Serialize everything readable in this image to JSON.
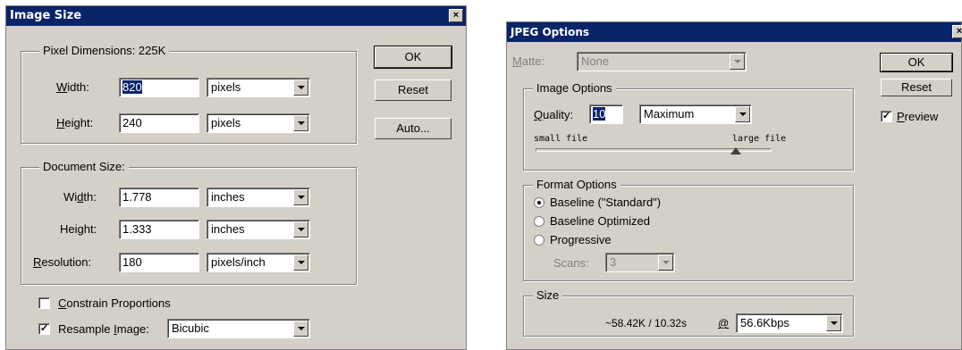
{
  "image_size": {
    "title": "Image Size",
    "close_glyph": "×",
    "pixel_dimensions": {
      "legend": "Pixel Dimensions: 225K",
      "width": {
        "label_pre": "",
        "label_key": "W",
        "label_post": "idth:",
        "value": "820",
        "unit": "pixels"
      },
      "height": {
        "label_pre": "",
        "label_key": "H",
        "label_post": "eight:",
        "value": "240",
        "unit": "pixels"
      }
    },
    "document_size": {
      "legend": "Document Size:",
      "width": {
        "label_pre": "Wi",
        "label_key": "d",
        "label_post": "th:",
        "value": "1.778",
        "unit": "inches"
      },
      "height": {
        "label_pre": "Hei",
        "label_key": "g",
        "label_post": "ht:",
        "value": "1.333",
        "unit": "inches"
      },
      "resolution": {
        "label_pre": "",
        "label_key": "R",
        "label_post": "esolution:",
        "value": "180",
        "unit": "pixels/inch"
      }
    },
    "constrain": {
      "label_pre": "",
      "label_key": "C",
      "label_post": "onstrain Proportions",
      "checked": false
    },
    "resample": {
      "label_pre": "Resample ",
      "label_key": "I",
      "label_post": "mage:",
      "checked": true,
      "value": "Bicubic"
    },
    "ok_label": "OK",
    "reset_label": "Reset",
    "auto_label": "Auto..."
  },
  "jpeg_options": {
    "title": "JPEG Options",
    "close_glyph": "×",
    "matte": {
      "label_pre": "",
      "label_key": "M",
      "label_post": "atte:",
      "value": "None"
    },
    "image_options": {
      "legend": "Image Options",
      "quality_label_pre": "",
      "quality_label_key": "Q",
      "quality_label_post": "uality:",
      "quality_value": "10",
      "quality_preset": "Maximum",
      "small_label": "small file",
      "large_label": "large file",
      "slider_level": 0.85
    },
    "format_options": {
      "legend": "Format Options",
      "options": [
        {
          "label": "Baseline (\"Standard\")",
          "selected": true
        },
        {
          "label": "Baseline Optimized",
          "selected": false
        },
        {
          "label": "Progressive",
          "selected": false
        }
      ],
      "scans_label": "Scans:",
      "scans_value": "3"
    },
    "size": {
      "legend": "Size",
      "estimate": "~58.42K / 10.32s",
      "at_symbol": "@",
      "speed": "56.6Kbps"
    },
    "ok_label": "OK",
    "reset_label": "Reset",
    "preview": {
      "label_pre": "",
      "label_key": "P",
      "label_post": "review",
      "checked": true
    }
  }
}
